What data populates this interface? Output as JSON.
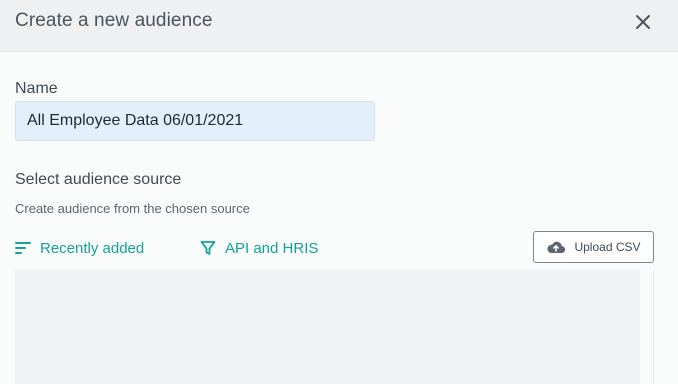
{
  "dialog": {
    "title": "Create a new audience",
    "close_icon": "close-icon"
  },
  "name_field": {
    "label": "Name",
    "value": "All Employee Data 06/01/2021"
  },
  "source": {
    "label": "Select audience source",
    "description": "Create audience from the chosen source"
  },
  "filters": {
    "recent": {
      "label": "Recently added",
      "icon": "sort-lines-icon"
    },
    "api": {
      "label": "API and HRIS",
      "icon": "filter-funnel-icon"
    }
  },
  "upload": {
    "label": "Upload CSV",
    "icon": "cloud-upload-icon"
  },
  "colors": {
    "accent": "#12a39b",
    "header_bg": "#eef0f1",
    "input_bg": "#e4effc"
  }
}
